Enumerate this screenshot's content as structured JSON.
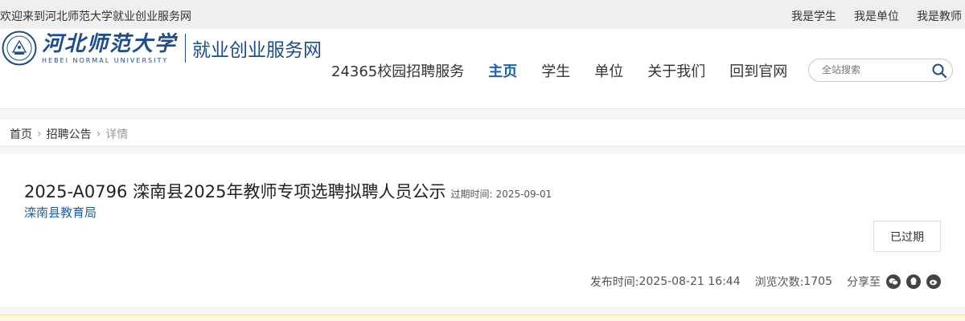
{
  "topbar": {
    "welcome": "欢迎来到河北师范大学就业创业服务网",
    "links": [
      "我是学生",
      "我是单位",
      "我是教师"
    ]
  },
  "header": {
    "logo_cn": "河北师范大学",
    "logo_en": "HEBEI NORMAL UNIVERSITY",
    "site_name": "就业创业服务网",
    "nav": [
      "24365校园招聘服务",
      "主页",
      "学生",
      "单位",
      "关于我们",
      "回到官网"
    ],
    "nav_active_index": 1,
    "search_placeholder": "全站搜索"
  },
  "breadcrumb": {
    "items": [
      "首页",
      "招聘公告",
      "详情"
    ]
  },
  "detail": {
    "title": "2025-A0796 滦南县2025年教师专项选聘拟聘人员公示",
    "expire_label": "过期时间:",
    "expire_value": "2025-09-01",
    "organization": "滦南县教育局",
    "status": "已过期",
    "publish_label": "发布时间:",
    "publish_value": "2025-08-21 16:44",
    "views_label": "浏览次数:",
    "views_value": "1705",
    "share_label": "分享至"
  },
  "colors": {
    "brand": "#1d4d8c",
    "link": "#1d62a8",
    "icon": "#444444"
  }
}
